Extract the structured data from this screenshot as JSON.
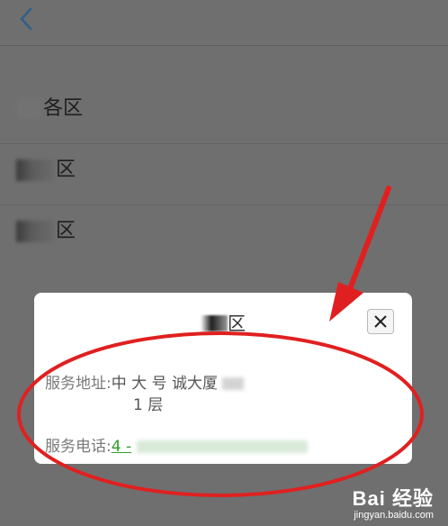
{
  "header": {
    "title": ""
  },
  "list": {
    "items": [
      {
        "label": "各区"
      },
      {
        "label": "区"
      },
      {
        "label": "区"
      }
    ]
  },
  "modal": {
    "title": "区",
    "address_label": "服务地址:",
    "address_value": "中 大 号 诚大厦",
    "address_line2": "1 层",
    "phone_label": "服务电话:",
    "phone_value": "4 -"
  },
  "watermark": {
    "brand": "Bai 经验",
    "url": "jingyan.baidu.com"
  },
  "colors": {
    "overlay": "#6f6f6f",
    "link_green": "#2f9e2f",
    "annotation_red": "#e02020"
  }
}
